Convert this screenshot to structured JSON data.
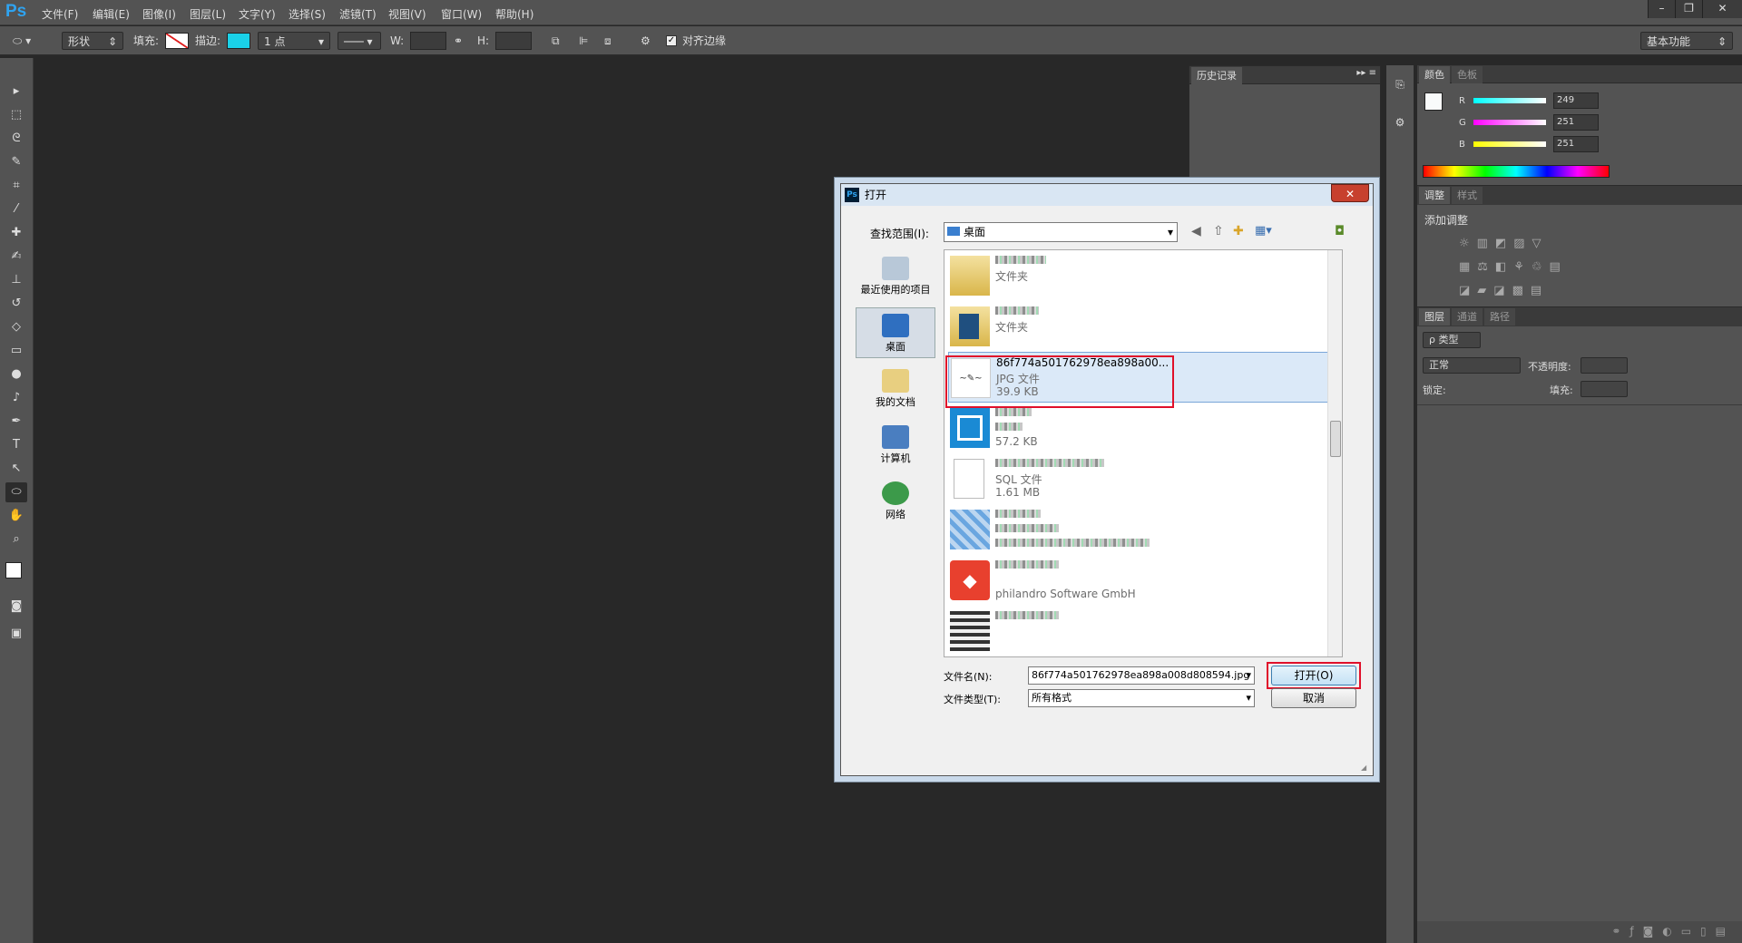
{
  "app": {
    "logo": "Ps"
  },
  "menu": [
    "文件(F)",
    "编辑(E)",
    "图像(I)",
    "图层(L)",
    "文字(Y)",
    "选择(S)",
    "滤镜(T)",
    "视图(V)",
    "窗口(W)",
    "帮助(H)"
  ],
  "window_controls": [
    "–",
    "❐",
    "✕"
  ],
  "options_bar": {
    "mode": "形状",
    "fill_label": "填充:",
    "stroke_label": "描边:",
    "stroke_width": "1 点",
    "w_label": "W:",
    "h_label": "H:",
    "align_edges_label": "对齐边缘",
    "workspace": "基本功能",
    "stroke_color": "#1ad1e8"
  },
  "history_panel": {
    "title": "历史记录"
  },
  "color_panel": {
    "tabs": [
      "颜色",
      "色板"
    ],
    "r_label": "R",
    "g_label": "G",
    "b_label": "B",
    "r": "249",
    "g": "251",
    "b": "251"
  },
  "adjust_panel": {
    "tabs": [
      "调整",
      "样式"
    ],
    "heading": "添加调整"
  },
  "layers_panel": {
    "tabs": [
      "图层",
      "通道",
      "路径"
    ],
    "filter_kind": "ρ 类型",
    "blend_mode": "正常",
    "opacity_label": "不透明度:",
    "lock_label": "锁定:",
    "fill_label": "填充:"
  },
  "dialog": {
    "title": "打开",
    "lookin_label": "查找范围(I):",
    "lookin_value": "桌面",
    "places": [
      "最近使用的项目",
      "桌面",
      "我的文档",
      "计算机",
      "网络"
    ],
    "files": [
      {
        "line2": "文件夹",
        "line3": ""
      },
      {
        "line2": "文件夹",
        "line3": ""
      },
      {
        "line1": "86f774a501762978ea898a00...",
        "line2": "JPG 文件",
        "line3": "39.9 KB"
      },
      {
        "line2": "",
        "line3": "57.2 KB"
      },
      {
        "line2": "SQL 文件",
        "line3": "1.61 MB"
      },
      {
        "line2": "",
        "line3": ""
      },
      {
        "line2": "",
        "line3": "philandro Software GmbH"
      },
      {
        "line2": "",
        "line3": ""
      }
    ],
    "filename_label": "文件名(N):",
    "filename_value": "86f774a501762978ea898a008d808594.jpg",
    "filetype_label": "文件类型(T):",
    "filetype_value": "所有格式",
    "open_button": "打开(O)",
    "cancel_button": "取消"
  }
}
